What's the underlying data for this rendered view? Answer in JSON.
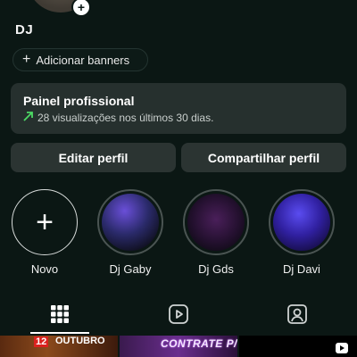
{
  "profile": {
    "username": "DJ",
    "add_banner_label": "Adicionar banners"
  },
  "panel": {
    "title": "Painel profissional",
    "stats": "28 visualizações nos últimos 30 dias."
  },
  "actions": {
    "edit_label": "Editar perfil",
    "share_label": "Compartilhar perfil"
  },
  "highlights": [
    {
      "label": "Novo"
    },
    {
      "label": "Dj Gaby"
    },
    {
      "label": "Dj Gds"
    },
    {
      "label": "Dj Davi"
    }
  ],
  "tabs": [
    {
      "icon": "grid-icon",
      "selected": true
    },
    {
      "icon": "reels-icon",
      "selected": false
    },
    {
      "icon": "tagged-icon",
      "selected": false
    }
  ],
  "posts": [
    {
      "date": "12",
      "month": "OUTUBRO"
    },
    {
      "text": "CONTRATE P/"
    },
    {
      "icon": "reel-icon"
    }
  ],
  "colors": {
    "background": "#0b1714",
    "panel": "#26302e",
    "button": "#2b3432",
    "trend": "#4cd964"
  }
}
